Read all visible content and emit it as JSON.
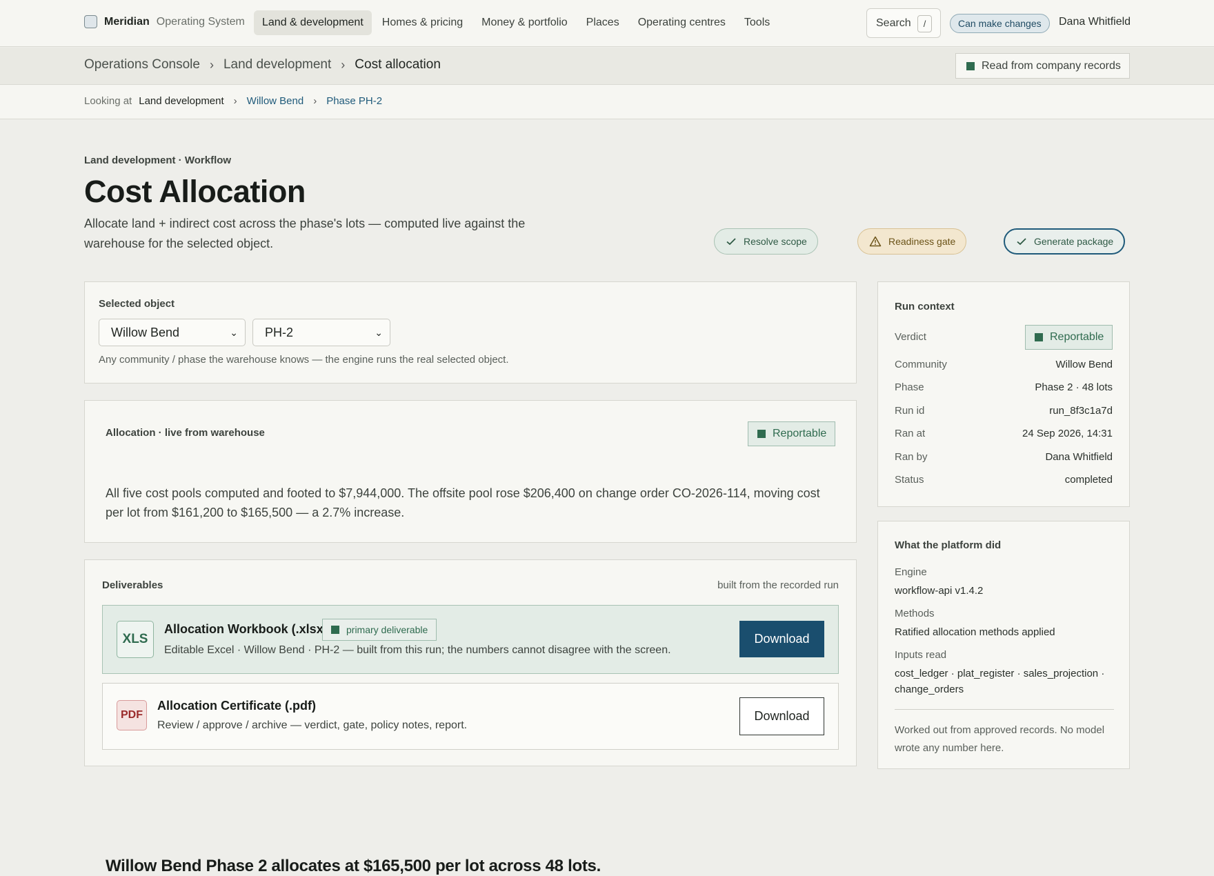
{
  "nav": {
    "brand": "Meridian",
    "brand_sub": "Operating System",
    "links": [
      "Land & development",
      "Homes & pricing",
      "Money & portfolio",
      "Places",
      "Operating centres",
      "Tools"
    ],
    "search_label": "Search",
    "search_key": "/",
    "permission": "Can make changes",
    "user": "Dana Whitfield"
  },
  "breadcrumb": {
    "items": [
      "Operations Console",
      "Land development",
      "Cost allocation"
    ],
    "records_label": "Read from company records"
  },
  "looking_at": {
    "label": "Looking at",
    "level": "Land development",
    "community": "Willow Bend",
    "phase": "Phase PH-2"
  },
  "header": {
    "eyebrow": "Land development · Workflow",
    "title": "Cost Allocation",
    "description": "Allocate land + indirect cost across the phase's lots — computed live against the warehouse for the selected object.",
    "steps": [
      {
        "label": "Resolve scope",
        "state": "done"
      },
      {
        "label": "Readiness gate",
        "state": "warn"
      },
      {
        "label": "Generate package",
        "state": "active"
      }
    ]
  },
  "selector": {
    "label": "Selected object",
    "community_value": "Willow Bend",
    "phase_value": "PH-2",
    "hint": "Any community / phase the warehouse knows — the engine runs the real selected object."
  },
  "allocation": {
    "label": "Allocation · live from warehouse",
    "badge": "Reportable",
    "headline": "Willow Bend Phase 2 allocates at $165,500 per lot across 48 lots.",
    "body": "All five cost pools computed and footed to $7,944,000. The offsite pool rose $206,400 on change order CO-2026-114, moving cost per lot from $161,200 to $165,500 — a 2.7% increase."
  },
  "deliverables": {
    "label": "Deliverables",
    "note": "built from the recorded run",
    "items": [
      {
        "icon": "XLS",
        "name": "Allocation Workbook (.xlsx)",
        "tag": "primary deliverable",
        "desc": "Editable Excel · Willow Bend · PH-2 — built from this run; the numbers cannot disagree with the screen.",
        "button": "Download"
      },
      {
        "icon": "PDF",
        "name": "Allocation Certificate (.pdf)",
        "desc": "Review / approve / archive — verdict, gate, policy notes, report.",
        "button": "Download"
      }
    ]
  },
  "run_context": {
    "title": "Run context",
    "verdict_label": "Verdict",
    "verdict": "Reportable",
    "rows": [
      {
        "k": "Community",
        "v": "Willow Bend"
      },
      {
        "k": "Phase",
        "v": "Phase 2 · 48 lots"
      },
      {
        "k": "Run id",
        "v": "run_8f3c1a7d"
      },
      {
        "k": "Ran at",
        "v": "24 Sep 2026, 14:31"
      },
      {
        "k": "Ran by",
        "v": "Dana Whitfield"
      },
      {
        "k": "Status",
        "v": "completed"
      }
    ]
  },
  "platform": {
    "title": "What the platform did",
    "engine_label": "Engine",
    "engine": "workflow-api v1.4.2",
    "methods_label": "Methods",
    "methods": "Ratified allocation methods applied",
    "inputs_label": "Inputs read",
    "inputs": "cost_ledger · plat_register · sales_projection · change_orders",
    "footer": "Worked out from approved records. No model wrote any number here."
  },
  "colors": {
    "accent": "#1a4e6e",
    "success": "#2f6b4f",
    "warning": "#6b5318"
  }
}
